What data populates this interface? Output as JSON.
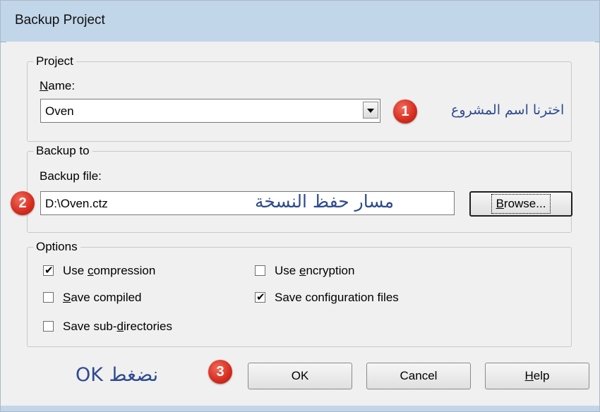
{
  "window": {
    "title": "Backup Project"
  },
  "project_group": {
    "legend": "Project",
    "name_label_mnemonic": "N",
    "name_label_rest": "ame:",
    "combo_value": "Oven"
  },
  "backup_group": {
    "legend": "Backup to",
    "file_label": "Backup file:",
    "path_value": "D:\\Oven.ctz",
    "browse_mnemonic": "B",
    "browse_rest": "rowse..."
  },
  "options_group": {
    "legend": "Options",
    "items": [
      {
        "pre": "Use ",
        "mnemonic": "c",
        "post": "ompression",
        "checked": true
      },
      {
        "pre": "",
        "mnemonic": "S",
        "post": "ave compiled",
        "checked": false
      },
      {
        "pre": "Save sub-",
        "mnemonic": "d",
        "post": "irectories",
        "checked": false
      },
      {
        "pre": "Use ",
        "mnemonic": "e",
        "post": "ncryption",
        "checked": false
      },
      {
        "pre": "Save confi",
        "mnemonic": "g",
        "post": "uration files",
        "checked": true
      }
    ]
  },
  "buttons": {
    "ok": "OK",
    "cancel": "Cancel",
    "help_mnemonic": "H",
    "help_rest": "elp"
  },
  "annotations": {
    "badge1": "1",
    "badge2": "2",
    "badge3": "3",
    "text1": "اخترنا اسم المشروع",
    "text2": "مسار حفظ النسخة",
    "text3": "نضغط OK"
  },
  "colors": {
    "titlebar": "#c2d6ea",
    "dialog_bg": "#f0f0f0",
    "badge": "#d52b1e",
    "annotation_text": "#2e4b8f"
  }
}
